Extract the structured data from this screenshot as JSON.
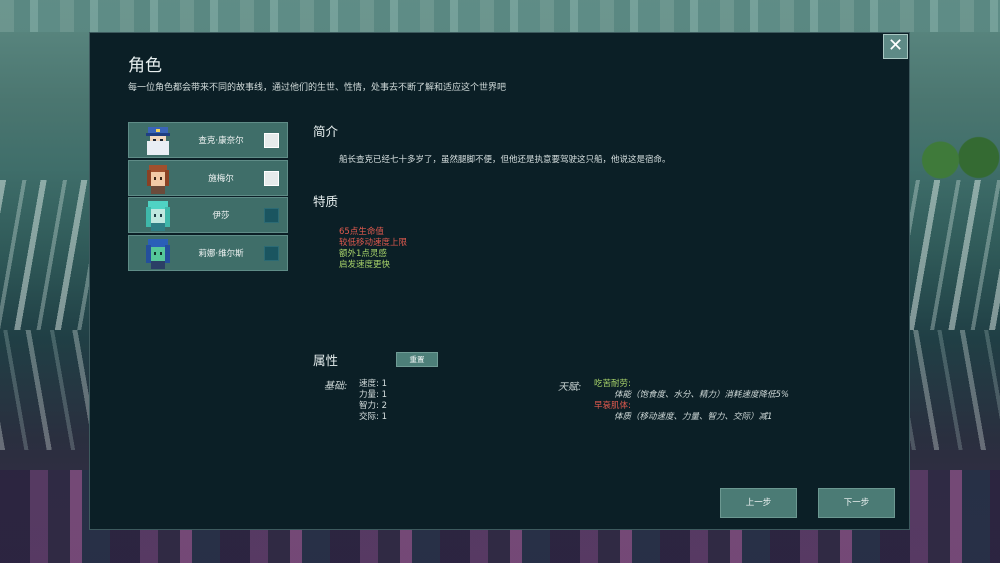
{
  "header": {
    "title": "角色",
    "subtitle": "每一位角色都会带来不同的故事线，通过他们的生世、性情，处事去不断了解和适应这个世界吧",
    "close_glyph": "✕"
  },
  "characters": [
    {
      "name": "查克·康奈尔",
      "selected": true,
      "colors": {
        "hair": "#e9eef4",
        "hat": "#3a64b8",
        "skin": "#f0d7c0"
      }
    },
    {
      "name": "施梅尔",
      "selected": true,
      "colors": {
        "hair": "#a0502e",
        "skin": "#f2c9a6"
      }
    },
    {
      "name": "伊莎",
      "selected": false,
      "colors": {
        "hair": "#4fd3c4",
        "skin": "#bfe8e0"
      }
    },
    {
      "name": "莉娜·维尔斯",
      "selected": false,
      "colors": {
        "hair": "#2a5fb8",
        "skin": "#55c79a"
      }
    }
  ],
  "intro": {
    "title": "简介",
    "text": "船长查克已经七十多岁了，虽然腿脚不便，但他还是执意要驾驶这只船，他说这是宿命。"
  },
  "traits": {
    "title": "特质",
    "items": [
      {
        "text": "65点生命值",
        "color": "#e05a4e"
      },
      {
        "text": "较低移动速度上限",
        "color": "#e05a4e"
      },
      {
        "text": "额外1点灵感",
        "color": "#a9d46a"
      },
      {
        "text": "启发速度更快",
        "color": "#a9d46a"
      }
    ]
  },
  "attributes": {
    "title": "属性",
    "reset_label": "重置",
    "base_label": "基础:",
    "base": [
      "速度: 1",
      "力量: 1",
      "智力: 2",
      "交际: 1"
    ],
    "talent_label": "天赋:",
    "talents": [
      {
        "name": "吃苦耐劳:",
        "name_color": "#a9d46a",
        "desc": "体能（饱食度、水分、精力）消耗速度降低5%"
      },
      {
        "name": "早衰肌体:",
        "name_color": "#e05a4e",
        "desc": "体质（移动速度、力量、智力、交际）减1"
      }
    ]
  },
  "nav": {
    "prev_label": "上一步",
    "next_label": "下一步"
  },
  "colors": {
    "panel_bg": "#0b1f26",
    "button_bg": "#4b7b75",
    "positive": "#a9d46a",
    "negative": "#e05a4e"
  }
}
